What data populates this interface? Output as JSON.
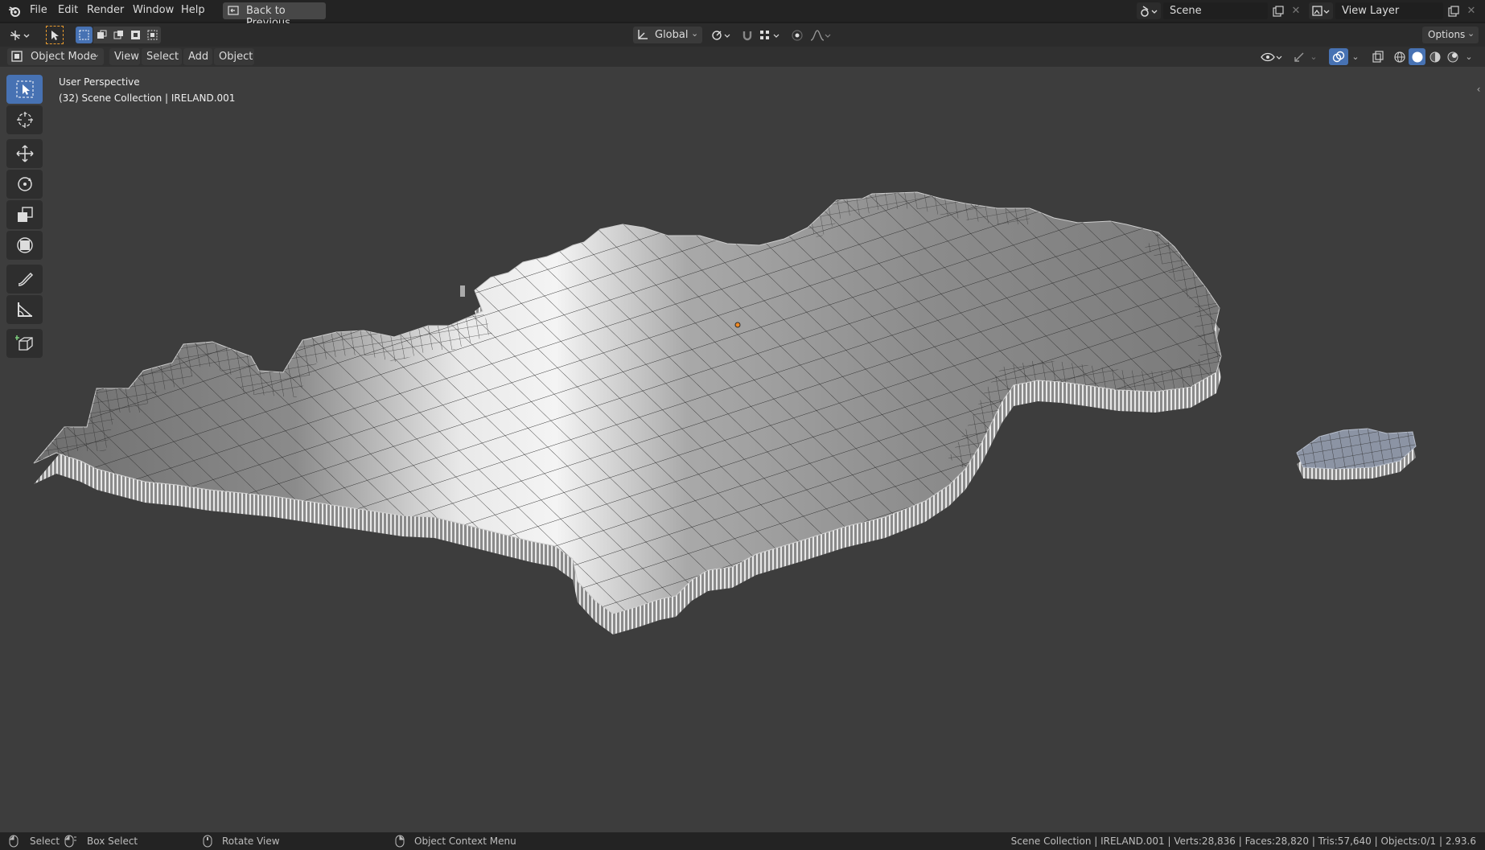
{
  "menubar": {
    "items": [
      "File",
      "Edit",
      "Render",
      "Window",
      "Help"
    ],
    "back_button": "Back to Previous",
    "scene_name": "Scene",
    "view_layer_name": "View Layer"
  },
  "tool_header": {
    "transform_orientation": "Global",
    "options_label": "Options"
  },
  "view_header": {
    "mode": "Object Mode",
    "menus": [
      "View",
      "Select",
      "Add",
      "Object"
    ]
  },
  "viewport": {
    "perspective_label": "User Perspective",
    "collection_label": "(32) Scene Collection | IRELAND.001"
  },
  "toolbar": {
    "tools": [
      "select-box",
      "cursor",
      "move",
      "rotate",
      "scale",
      "transform",
      "annotate",
      "measure",
      "add-cube"
    ],
    "active": "select-box"
  },
  "statusbar": {
    "hint_select": "Select",
    "hint_box_select": "Box Select",
    "hint_rotate": "Rotate View",
    "hint_context": "Object Context Menu",
    "stats": "Scene Collection | IRELAND.001 | Verts:28,836 | Faces:28,820 | Tris:57,640 | Objects:0/1 | 2.93.6"
  },
  "colors": {
    "accent": "#4772b3",
    "viewport_bg": "#3d3d3d",
    "header_bg": "#303030",
    "origin_dot": "#f08a24"
  }
}
